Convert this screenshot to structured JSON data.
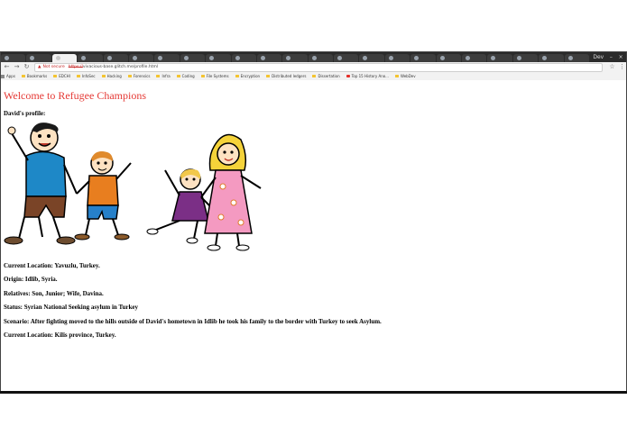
{
  "browser": {
    "tabs": [
      "",
      "",
      "",
      "",
      "",
      "",
      "",
      "",
      "",
      "",
      "",
      "",
      "",
      "",
      "",
      "",
      "",
      "",
      "",
      "",
      "",
      "",
      ""
    ],
    "active_tab_index": 2,
    "window_user": "Dev",
    "address_bar": {
      "security_label": "Not secure",
      "scheme": "https://",
      "url_rest": "vivacious-base.glitch.me/profile.html"
    },
    "bookmarks": [
      {
        "label": "Apps",
        "icon": "apps-icon"
      },
      {
        "label": "Bookmarks",
        "icon": "folder-icon"
      },
      {
        "label": "EDCHI",
        "icon": "folder-icon"
      },
      {
        "label": "InfoSec",
        "icon": "folder-icon"
      },
      {
        "label": "Hacking",
        "icon": "folder-icon"
      },
      {
        "label": "Forensics",
        "icon": "folder-icon"
      },
      {
        "label": "Infra",
        "icon": "folder-icon"
      },
      {
        "label": "Coding",
        "icon": "folder-icon"
      },
      {
        "label": "File Systems",
        "icon": "folder-icon"
      },
      {
        "label": "Encryption",
        "icon": "folder-icon"
      },
      {
        "label": "Distributed ledgers",
        "icon": "folder-icon"
      },
      {
        "label": "Dissertation",
        "icon": "folder-icon"
      },
      {
        "label": "Top 15 History Ano...",
        "icon": "youtube-icon"
      },
      {
        "label": "WebDev",
        "icon": "folder-icon"
      }
    ]
  },
  "page": {
    "title": "Welcome to Refugee Champions",
    "subheading": "David's profile:",
    "details": [
      "Current Location: Yavuzlu, Turkey.",
      "Origin: Idlib, Syria.",
      "Relatives: Son, Junior; Wife, Davina.",
      "Status: Syrian National Seeking asylum in Turkey",
      "Scenario: After fighting moved to the hills outside of David's hometown in Idlib he took his family to the border with Turkey to seek Asylum.",
      "Current Location: Kilis province, Turkey."
    ]
  },
  "colors": {
    "title": "#e53935",
    "tabstrip": "#2b2b2b",
    "toolbar": "#f2f2f2"
  }
}
